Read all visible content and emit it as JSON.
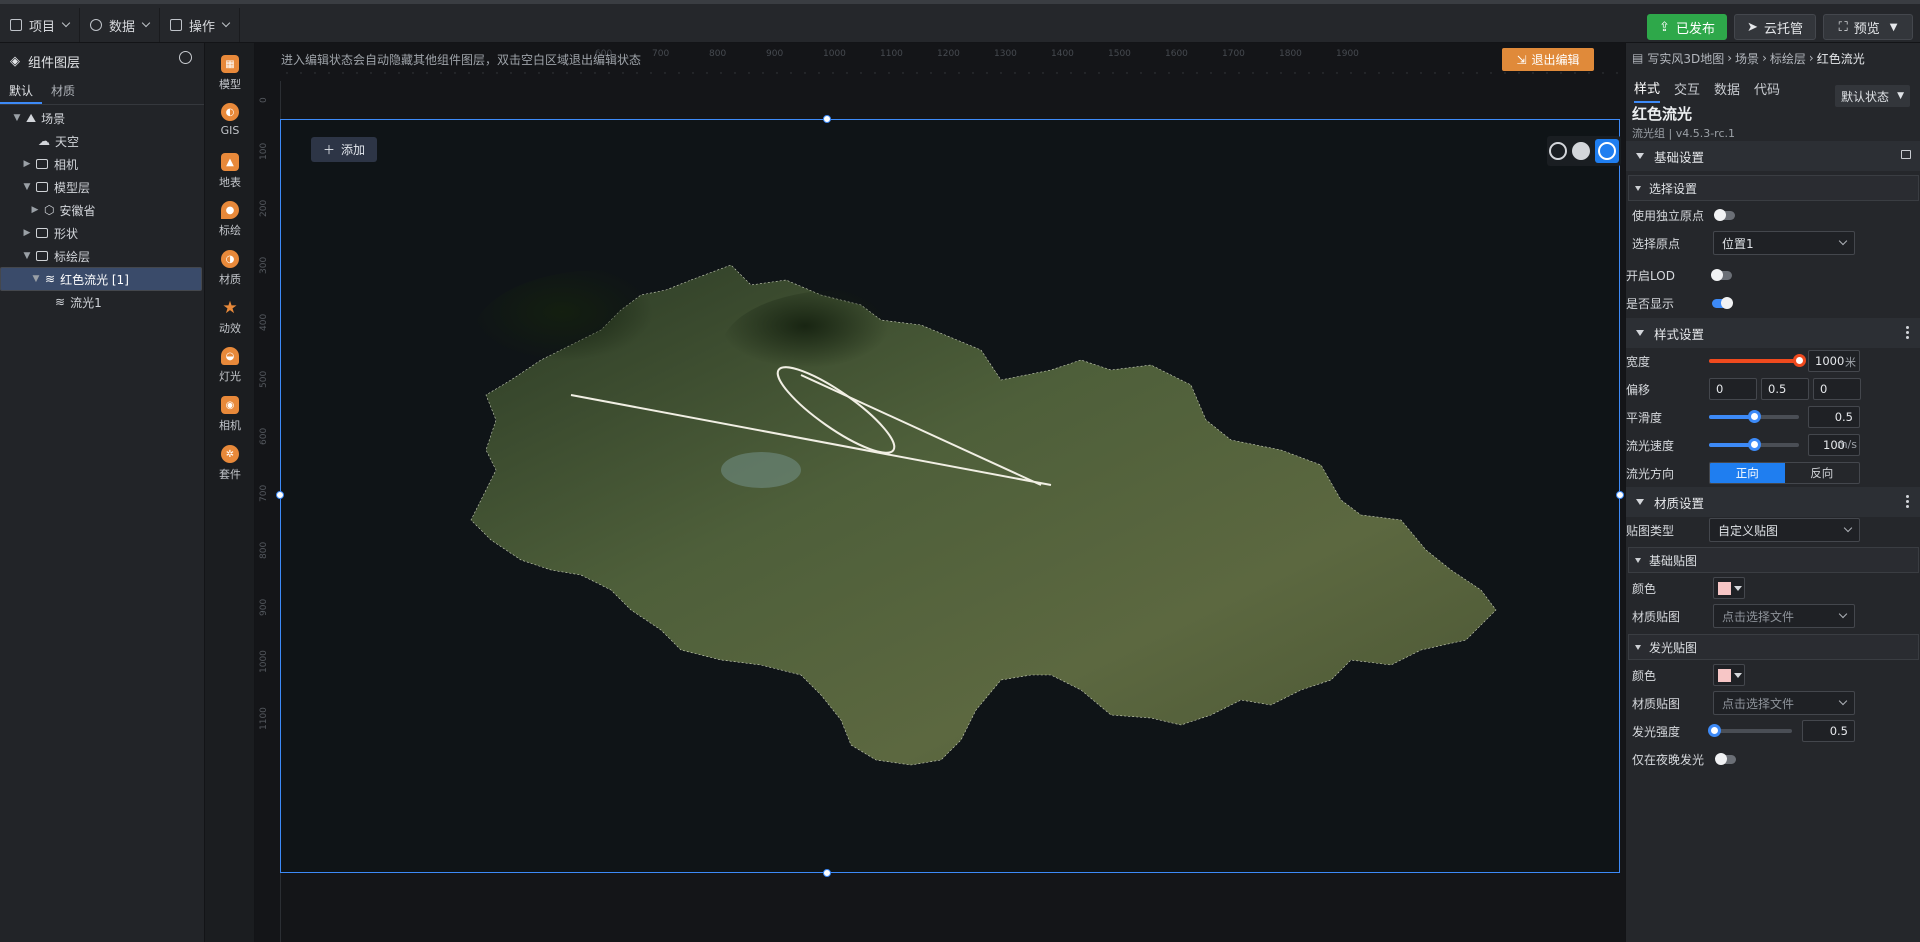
{
  "topbar": {
    "menus": [
      "项目",
      "数据",
      "操作"
    ],
    "publish_label": "已发布",
    "cloud_label": "云托管",
    "preview_label": "预览"
  },
  "left_panel": {
    "title": "组件图层",
    "tabs": [
      "默认",
      "材质"
    ],
    "tree": [
      {
        "label": "场景",
        "expanded": true
      },
      {
        "label": "天空"
      },
      {
        "label": "相机",
        "expanded": false
      },
      {
        "label": "模型层",
        "expanded": true
      },
      {
        "label": "安徽省",
        "expanded": false
      },
      {
        "label": "形状",
        "expanded": false
      },
      {
        "label": "标绘层",
        "expanded": true
      },
      {
        "label": "红色流光 [1]",
        "expanded": true,
        "selected": true
      },
      {
        "label": "流光1"
      }
    ]
  },
  "toolbar": {
    "items": [
      "模型",
      "GIS",
      "地表",
      "标绘",
      "材质",
      "动效",
      "灯光",
      "相机",
      "套件"
    ]
  },
  "canvas": {
    "hint": "进入编辑状态会自动隐藏其他组件图层，双击空白区域退出编辑状态",
    "exit_label": "退出编辑",
    "add_label": "添加",
    "ruler_h": [
      "600",
      "700",
      "800",
      "900",
      "1000",
      "1100",
      "1200",
      "1300",
      "1400",
      "1500",
      "1600",
      "1700",
      "1800",
      "1900"
    ],
    "ruler_v": [
      "0",
      "100",
      "200",
      "300",
      "400",
      "500",
      "600",
      "700",
      "800",
      "900",
      "1000",
      "1100"
    ]
  },
  "right_panel": {
    "breadcrumb": [
      "写实风3D地图",
      "场景",
      "标绘层",
      "红色流光"
    ],
    "tabs": [
      "样式",
      "交互",
      "数据",
      "代码"
    ],
    "state_select": "默认状态",
    "component_name": "红色流光",
    "component_version": "流光组 | v4.5.3-rc.1",
    "basic": {
      "title": "基础设置",
      "select_section": "选择设置",
      "use_origin_label": "使用独立原点",
      "use_origin": false,
      "origin_label": "选择原点",
      "origin_value": "位置1",
      "lod_label": "开启LOD",
      "lod": false,
      "visible_label": "是否显示",
      "visible": true
    },
    "style": {
      "title": "样式设置",
      "width_label": "宽度",
      "width_value": "1000",
      "width_unit": "米",
      "width_fraction": 1.0,
      "offset_label": "偏移",
      "offset_values": [
        "0",
        "0.5",
        "0"
      ],
      "smooth_label": "平滑度",
      "smooth_value": "0.5",
      "smooth_fraction": 0.5,
      "speed_label": "流光速度",
      "speed_value": "100",
      "speed_unit": "m/s",
      "speed_fraction": 0.5,
      "direction_label": "流光方向",
      "direction_options": [
        "正向",
        "反向"
      ]
    },
    "material": {
      "title": "材质设置",
      "map_type_label": "贴图类型",
      "map_type_value": "自定义贴图",
      "base_section": "基础贴图",
      "color_label": "颜色",
      "texture_label": "材质贴图",
      "texture_placeholder": "点击选择文件",
      "glow_section": "发光贴图",
      "glow_color_label": "颜色",
      "glow_texture_label": "材质贴图",
      "glow_texture_placeholder": "点击选择文件",
      "glow_strength_label": "发光强度",
      "glow_strength_value": "0.5",
      "glow_strength_fraction": 0.0,
      "night_only_label": "仅在夜晚发光",
      "night_only": false
    }
  },
  "colors": {
    "accent": "#3d8af7",
    "publish": "#2ea84a",
    "exit": "#e08a3a",
    "width_slider": "#f04a1e",
    "swatch": "#f7c6c6"
  }
}
